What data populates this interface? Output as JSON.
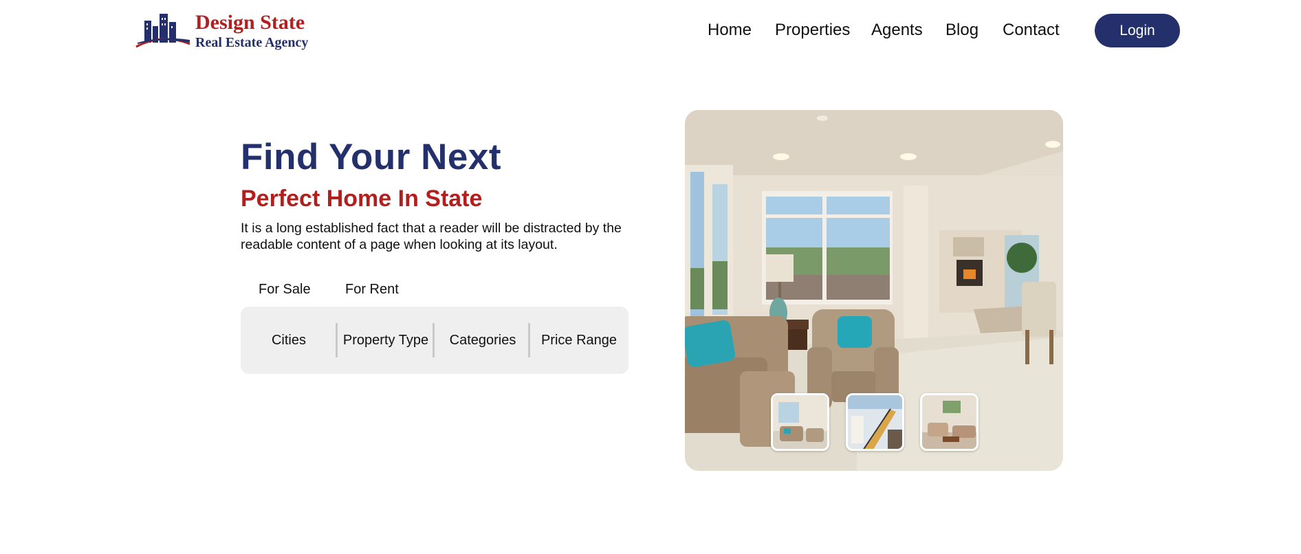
{
  "brand": {
    "name": "Design State",
    "tagline": "Real Estate Agency",
    "primary_color": "#24306b",
    "accent_color": "#b21f1f"
  },
  "nav": {
    "items": [
      {
        "label": "Home"
      },
      {
        "label": "Properties"
      },
      {
        "label": "Agents"
      },
      {
        "label": "Blog"
      },
      {
        "label": "Contact"
      }
    ],
    "login_label": "Login"
  },
  "hero": {
    "title": "Find Your Next",
    "subtitle": "Perfect Home In State",
    "description": "It is a long established fact that a reader will be distracted by the readable content of a page when looking at its layout."
  },
  "search": {
    "tabs": [
      {
        "label": "For Sale"
      },
      {
        "label": "For Rent"
      }
    ],
    "filters": [
      {
        "label": "Cities"
      },
      {
        "label": "Property Type"
      },
      {
        "label": "Categories"
      },
      {
        "label": "Price Range"
      }
    ]
  },
  "gallery": {
    "main_image": "living-room-photo",
    "thumbnails": [
      {
        "image": "living-room-thumbnail"
      },
      {
        "image": "staircase-thumbnail"
      },
      {
        "image": "lounge-thumbnail"
      }
    ]
  }
}
